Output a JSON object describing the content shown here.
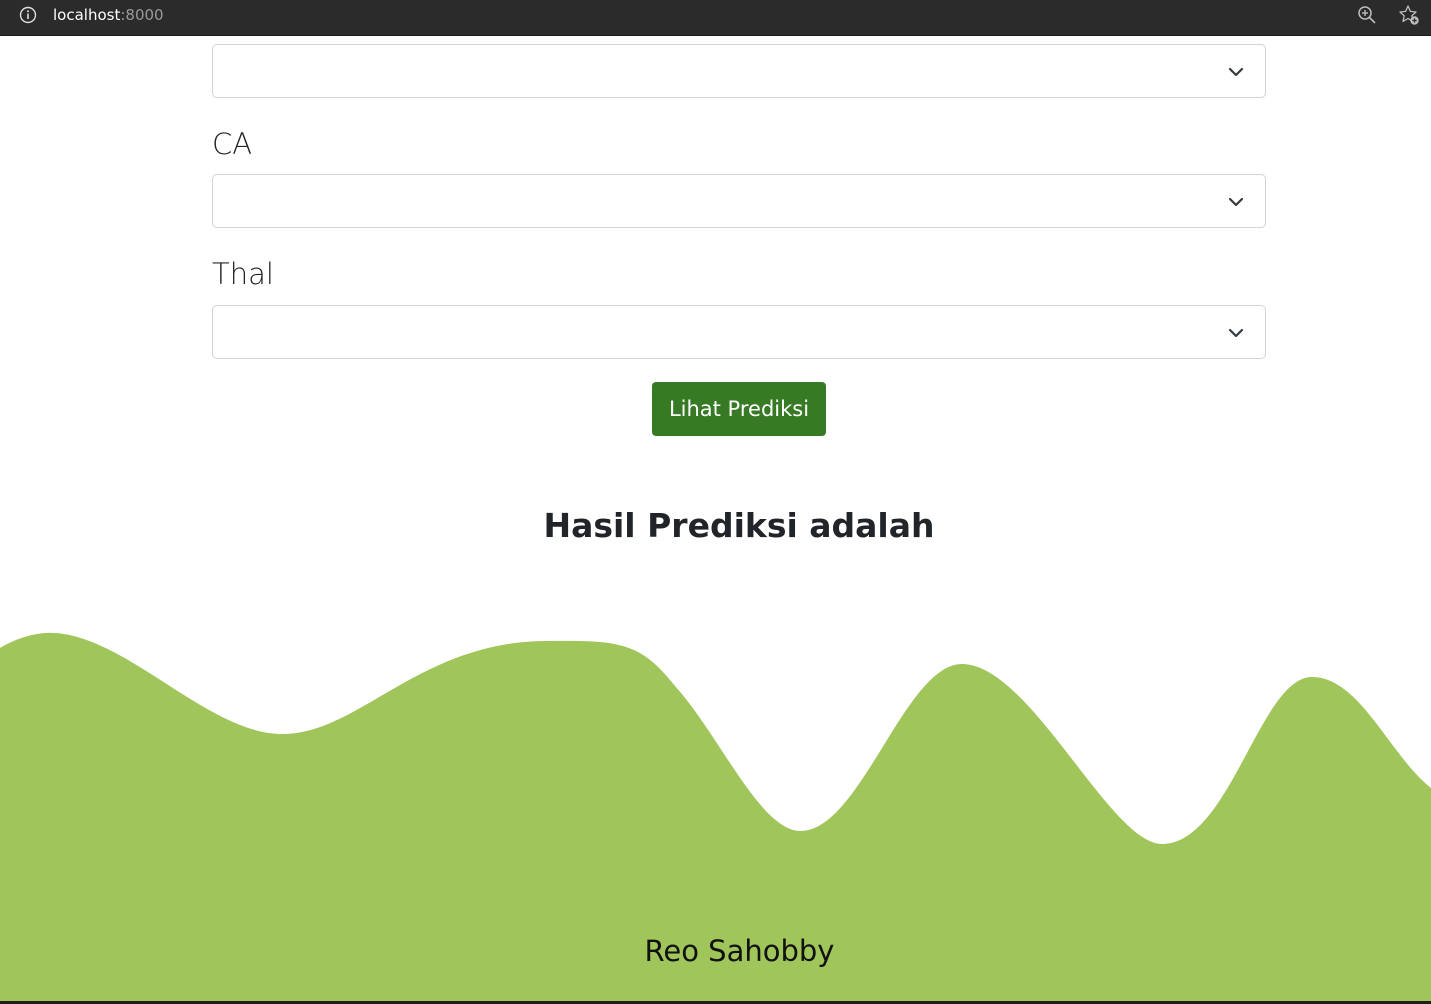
{
  "browser": {
    "url_host": "localhost",
    "url_port": ":8000",
    "icons": [
      "info-icon",
      "zoom-icon",
      "add-favorite-icon"
    ]
  },
  "form": {
    "top_select": {
      "value": ""
    },
    "fields": [
      {
        "label": "CA",
        "value": ""
      },
      {
        "label": "Thal",
        "value": ""
      }
    ],
    "submit_label": "Lihat Prediksi"
  },
  "result": {
    "heading": "Hasil Prediksi adalah"
  },
  "footer": {
    "author": "Reo Sahobby"
  },
  "colors": {
    "accent_button": "#367a24",
    "wave": "#a0c55a",
    "toolbar": "#2b2b2b"
  }
}
